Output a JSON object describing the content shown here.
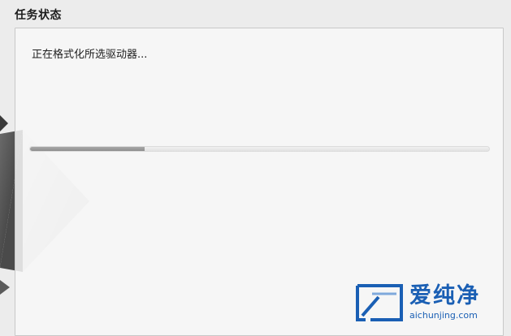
{
  "header": {
    "title": "任务状态"
  },
  "task": {
    "status_text": "正在格式化所选驱动器...",
    "progress": 0.25
  },
  "watermark": {
    "brand_text": "爱纯净",
    "url": "aichunjing.com"
  },
  "colors": {
    "page_bg": "#ececec",
    "panel_bg": "#f7f7f7",
    "progress_fill": "#999999",
    "watermark_blue": "#1a5fb4"
  }
}
